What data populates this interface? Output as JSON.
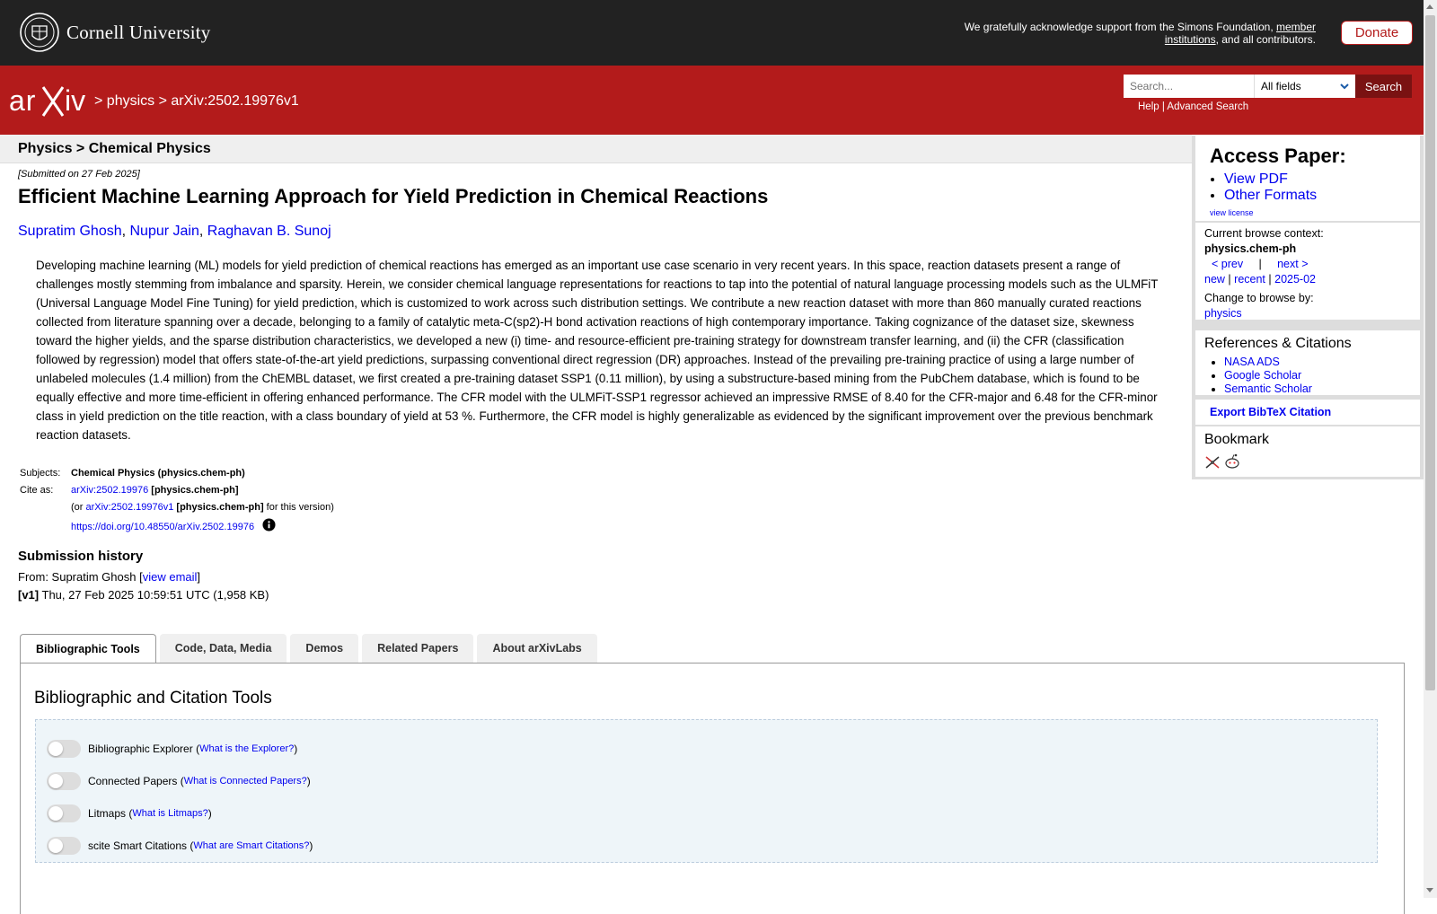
{
  "cornell": {
    "name": "Cornell University",
    "ack_text": "We gratefully acknowledge support from the Simons Foundation, ",
    "ack_link": "member institutions",
    "ack_tail": ", and all contributors.",
    "donate_label": "Donate"
  },
  "header": {
    "crumb_sep": ">",
    "crumb_section": "physics",
    "crumb_id": "arXiv:2502.19976v1",
    "search_placeholder": "Search...",
    "field_selected": "All fields",
    "search_button": "Search",
    "help_link": "Help",
    "advanced_link": "Advanced Search",
    "link_sep": "|"
  },
  "paper": {
    "subject_header": "Physics > Chemical Physics",
    "submitted": "[Submitted on 27 Feb 2025]",
    "title": "Efficient Machine Learning Approach for Yield Prediction in Chemical Reactions",
    "authors": [
      "Supratim Ghosh",
      "Nupur Jain",
      "Raghavan B. Sunoj"
    ],
    "abstract": "Developing machine learning (ML) models for yield prediction of chemical reactions has emerged as an important use case scenario in very recent years. In this space, reaction datasets present a range of challenges mostly stemming from imbalance and sparsity. Herein, we consider chemical language representations for reactions to tap into the potential of natural language processing models such as the ULMFiT (Universal Language Model Fine Tuning) for yield prediction, which is customized to work across such distribution settings. We contribute a new reaction dataset with more than 860 manually curated reactions collected from literature spanning over a decade, belonging to a family of catalytic meta-C(sp2)-H bond activation reactions of high contemporary importance. Taking cognizance of the dataset size, skewness toward the higher yields, and the sparse distribution characteristics, we developed a new (i) time- and resource-efficient pre-training strategy for downstream transfer learning, and (ii) the CFR (classification followed by regression) model that offers state-of-the-art yield predictions, surpassing conventional direct regression (DR) approaches. Instead of the prevailing pre-training practice of using a large number of unlabeled molecules (1.4 million) from the ChEMBL dataset, we first created a pre-training dataset SSP1 (0.11 million), by using a substructure-based mining from the PubChem database, which is found to be equally effective and more time-efficient in offering enhanced performance. The CFR model with the ULMFiT-SSP1 regressor achieved an impressive RMSE of 8.40 for the CFR-major and 6.48 for the CFR-minor class in yield prediction on the title reaction, with a class boundary of yield at 53 %. Furthermore, the CFR model is highly generalizable as evidenced by the significant improvement over the previous benchmark reaction datasets.",
    "subjects_label": "Subjects:",
    "subjects_value": "Chemical Physics (physics.chem-ph)",
    "cite_label": "Cite as:",
    "cite_id": "arXiv:2502.19976",
    "cite_cat": "[physics.chem-ph]",
    "cite_or": "(or ",
    "cite_version_id": "arXiv:2502.19976v1",
    "cite_version_cat": "[physics.chem-ph]",
    "cite_version_tail": " for this version)",
    "doi": "https://doi.org/10.48550/arXiv.2502.19976"
  },
  "history": {
    "heading": "Submission history",
    "from_prefix": "From: Supratim Ghosh [",
    "view_email": "view email",
    "from_suffix": "]",
    "v1_label": "[v1]",
    "v1_text": " Thu, 27 Feb 2025 10:59:51 UTC (1,958 KB)"
  },
  "tabs": [
    {
      "label": "Bibliographic Tools",
      "active": true
    },
    {
      "label": "Code, Data, Media",
      "active": false
    },
    {
      "label": "Demos",
      "active": false
    },
    {
      "label": "Related Papers",
      "active": false
    },
    {
      "label": "About arXivLabs",
      "active": false
    }
  ],
  "panel": {
    "title": "Bibliographic and Citation Tools",
    "tools": [
      {
        "name": "Bibliographic Explorer",
        "link": "What is the Explorer?"
      },
      {
        "name": "Connected Papers",
        "link": "What is Connected Papers?"
      },
      {
        "name": "Litmaps",
        "link": "What is Litmaps?"
      },
      {
        "name": "scite Smart Citations",
        "link": "What are Smart Citations?"
      }
    ]
  },
  "sidebar": {
    "access_title": "Access Paper:",
    "view_pdf": "View PDF",
    "other_formats": "Other Formats",
    "view_license": "view license",
    "context_label": "Current browse context:",
    "context_value": "physics.chem-ph",
    "prev": "< prev",
    "pipe": "|",
    "next": "next >",
    "new": "new",
    "recent": "recent",
    "month": "2025-02",
    "change_label": "Change to browse by:",
    "change_value": "physics",
    "refs_title": "References & Citations",
    "refs": [
      "NASA ADS",
      "Google Scholar",
      "Semantic Scholar"
    ],
    "export": "Export BibTeX Citation",
    "bookmark_title": "Bookmark"
  },
  "colors": {
    "arxiv_red": "#b31b1b",
    "cornell_dark": "#222222",
    "link_blue": "#0000ee"
  }
}
